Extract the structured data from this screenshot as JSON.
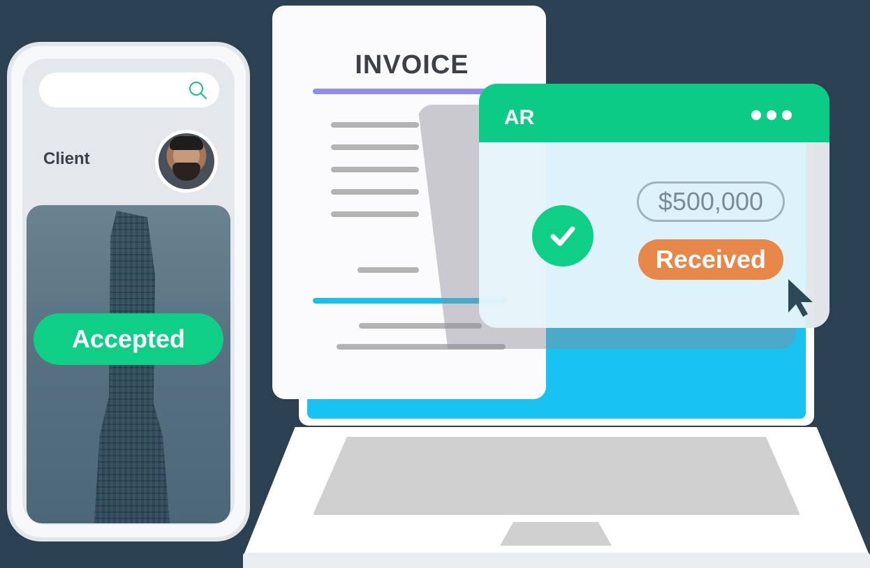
{
  "phone": {
    "search": {
      "icon": "search-icon"
    },
    "client_label": "Client",
    "status": "Accepted"
  },
  "invoice": {
    "title": "INVOICE"
  },
  "ar_window": {
    "title": "AR",
    "amount": "$500,000",
    "status": "Received",
    "icons": [
      "check-icon",
      "more-dots-icon",
      "cursor-icon"
    ]
  },
  "colors": {
    "background": "#2b4050",
    "accent_green": "#0fcf86",
    "accent_blue": "#18c3f2",
    "accent_orange": "#e8874a",
    "accent_purple": "#8f8cf2"
  }
}
